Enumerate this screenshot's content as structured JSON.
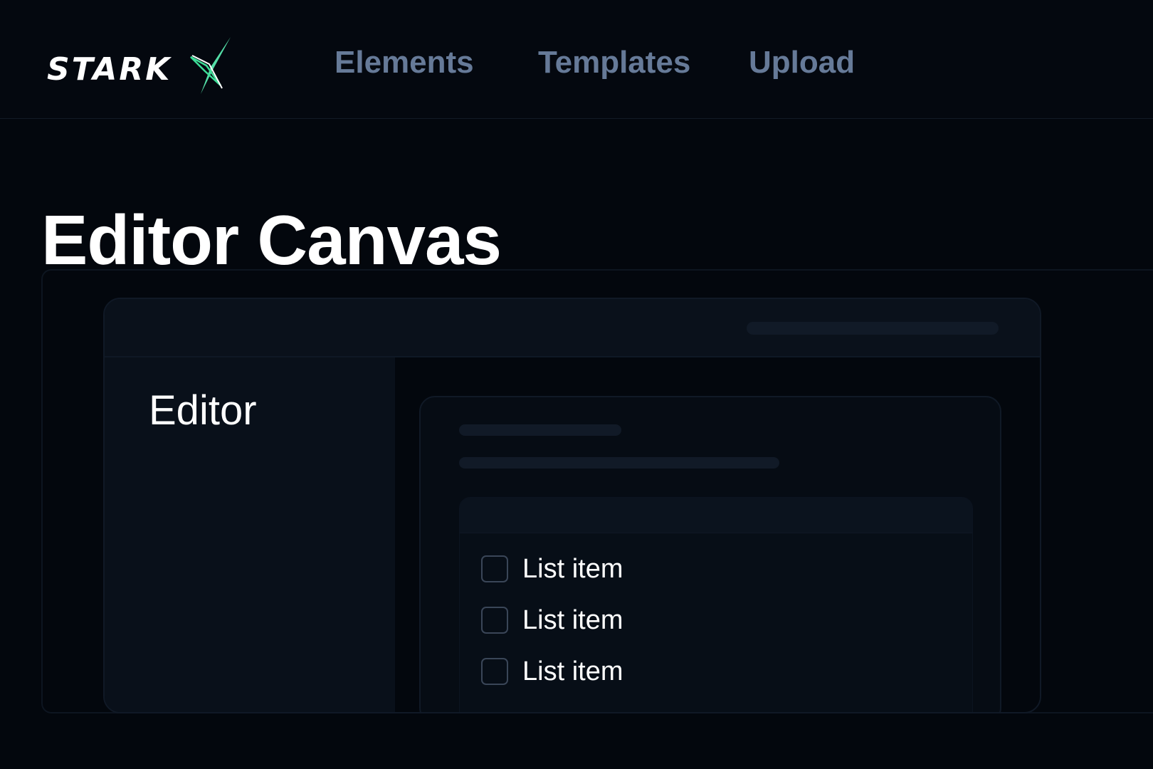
{
  "brand": {
    "logo_text": "STARK",
    "accent_color": "#3ddc97"
  },
  "nav": {
    "items": [
      {
        "label": "Elements"
      },
      {
        "label": "Templates"
      },
      {
        "label": "Upload"
      }
    ]
  },
  "page": {
    "title": "Editor Canvas"
  },
  "editor": {
    "sidebar_title": "Editor",
    "list": {
      "items": [
        {
          "label": "List item",
          "checked": false
        },
        {
          "label": "List item",
          "checked": false
        },
        {
          "label": "List item",
          "checked": false
        }
      ]
    }
  }
}
